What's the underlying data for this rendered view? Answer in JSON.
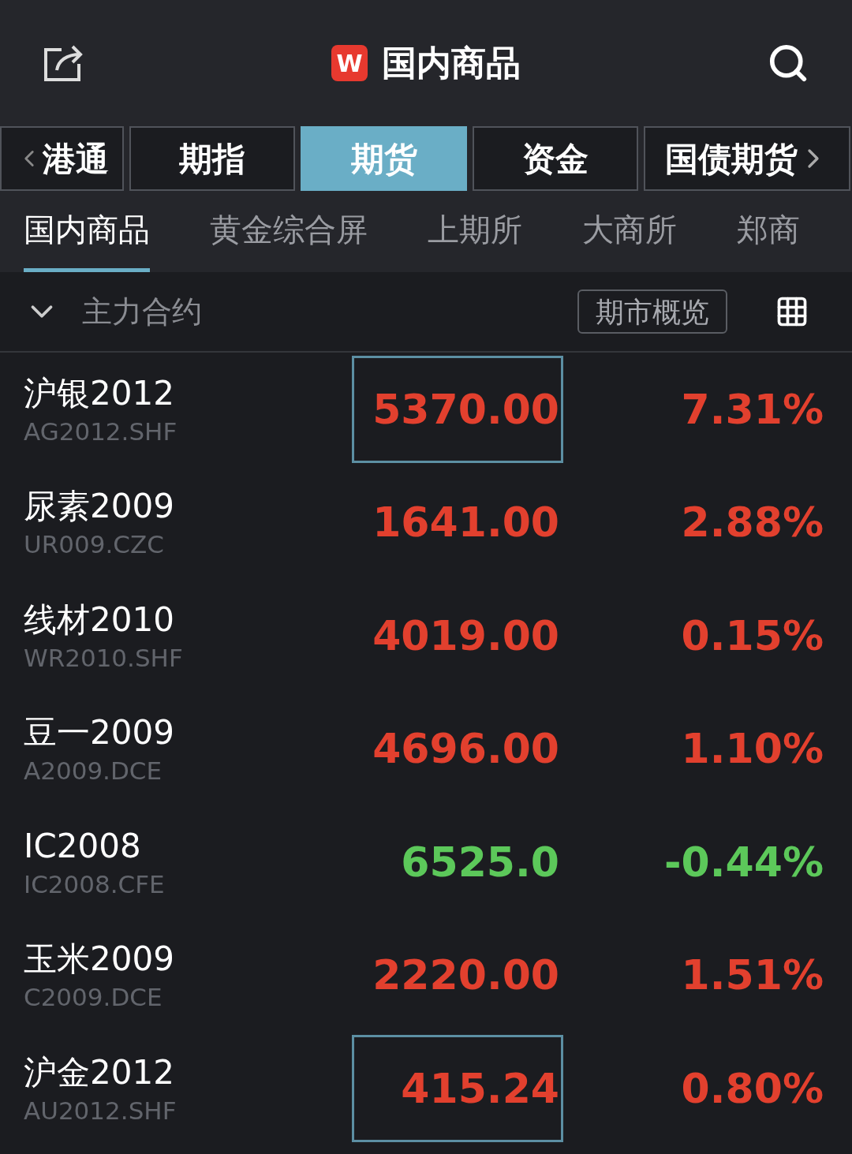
{
  "header": {
    "title": "国内商品",
    "logo": "W"
  },
  "tabs": [
    {
      "label": "港通",
      "selected": false,
      "kind": "back"
    },
    {
      "label": "期指",
      "selected": false,
      "kind": "plain"
    },
    {
      "label": "期货",
      "selected": true,
      "kind": "plain"
    },
    {
      "label": "资金",
      "selected": false,
      "kind": "plain"
    },
    {
      "label": "国债期货",
      "selected": false,
      "kind": "more"
    }
  ],
  "subtabs": [
    {
      "label": "国内商品",
      "selected": true
    },
    {
      "label": "黄金综合屏",
      "selected": false
    },
    {
      "label": "上期所",
      "selected": false
    },
    {
      "label": "大商所",
      "selected": false
    },
    {
      "label": "郑商",
      "selected": false
    }
  ],
  "section": {
    "title": "主力合约",
    "expanded": true,
    "button": "期市概览"
  },
  "rows": [
    {
      "name": "沪银2012",
      "code": "AG2012.SHF",
      "price": "5370.00",
      "change": "7.31%",
      "color": "#e2402e",
      "highlighted": true
    },
    {
      "name": "尿素2009",
      "code": "UR009.CZC",
      "price": "1641.00",
      "change": "2.88%",
      "color": "#e2402e",
      "highlighted": false
    },
    {
      "name": "线材2010",
      "code": "WR2010.SHF",
      "price": "4019.00",
      "change": "0.15%",
      "color": "#e2402e",
      "highlighted": false
    },
    {
      "name": "豆一2009",
      "code": "A2009.DCE",
      "price": "4696.00",
      "change": "1.10%",
      "color": "#e2402e",
      "highlighted": false
    },
    {
      "name": "IC2008",
      "code": "IC2008.CFE",
      "price": "6525.0",
      "change": "-0.44%",
      "color": "#5cc85a",
      "highlighted": false
    },
    {
      "name": "玉米2009",
      "code": "C2009.DCE",
      "price": "2220.00",
      "change": "1.51%",
      "color": "#e2402e",
      "highlighted": false
    },
    {
      "name": "沪金2012",
      "code": "AU2012.SHF",
      "price": "415.24",
      "change": "0.80%",
      "color": "#e2402e",
      "highlighted": true
    }
  ]
}
